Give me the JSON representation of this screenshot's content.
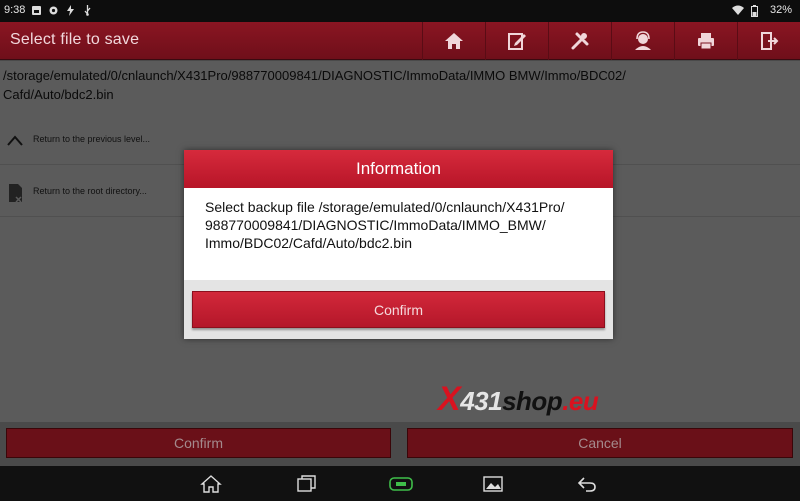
{
  "status_bar": {
    "time": "9:38",
    "battery": "32%",
    "icons": [
      "image-icon",
      "gear-icon",
      "flash-icon",
      "usb-icon",
      "wifi-icon",
      "battery-icon"
    ]
  },
  "header": {
    "title": "Select file to save",
    "toolbar": [
      "home-icon",
      "edit-icon",
      "tools-icon",
      "support-icon",
      "print-icon",
      "exit-icon"
    ]
  },
  "content": {
    "path_line1": "/storage/emulated/0/cnlaunch/X431Pro/988770009841/DIAGNOSTIC/ImmoData/IMMO BMW/Immo/BDC02/",
    "path_line2": "Cafd/Auto/bdc2.bin",
    "rows": [
      {
        "label": "Return to the previous level...",
        "icon": "chevron-up-icon"
      },
      {
        "label": "Return to the root directory...",
        "icon": "root-folder-icon"
      }
    ]
  },
  "buttons": {
    "confirm": "Confirm",
    "cancel": "Cancel"
  },
  "dialog": {
    "title": "Information",
    "line1": "Select backup file /storage/emulated/0/cnlaunch/X431Pro/",
    "line2": "988770009841/DIAGNOSTIC/ImmoData/IMMO_BMW/",
    "line3": "Immo/BDC02/Cafd/Auto/bdc2.bin",
    "confirm": "Confirm"
  },
  "watermark": {
    "x": "X",
    "num": "431",
    "shop": "shop",
    "eu": ".eu"
  },
  "nav": [
    "home-icon",
    "recents-icon",
    "vci-icon",
    "screenshot-icon",
    "back-icon"
  ],
  "colors": {
    "accent": "#c01e30",
    "header": "#7d1320"
  }
}
